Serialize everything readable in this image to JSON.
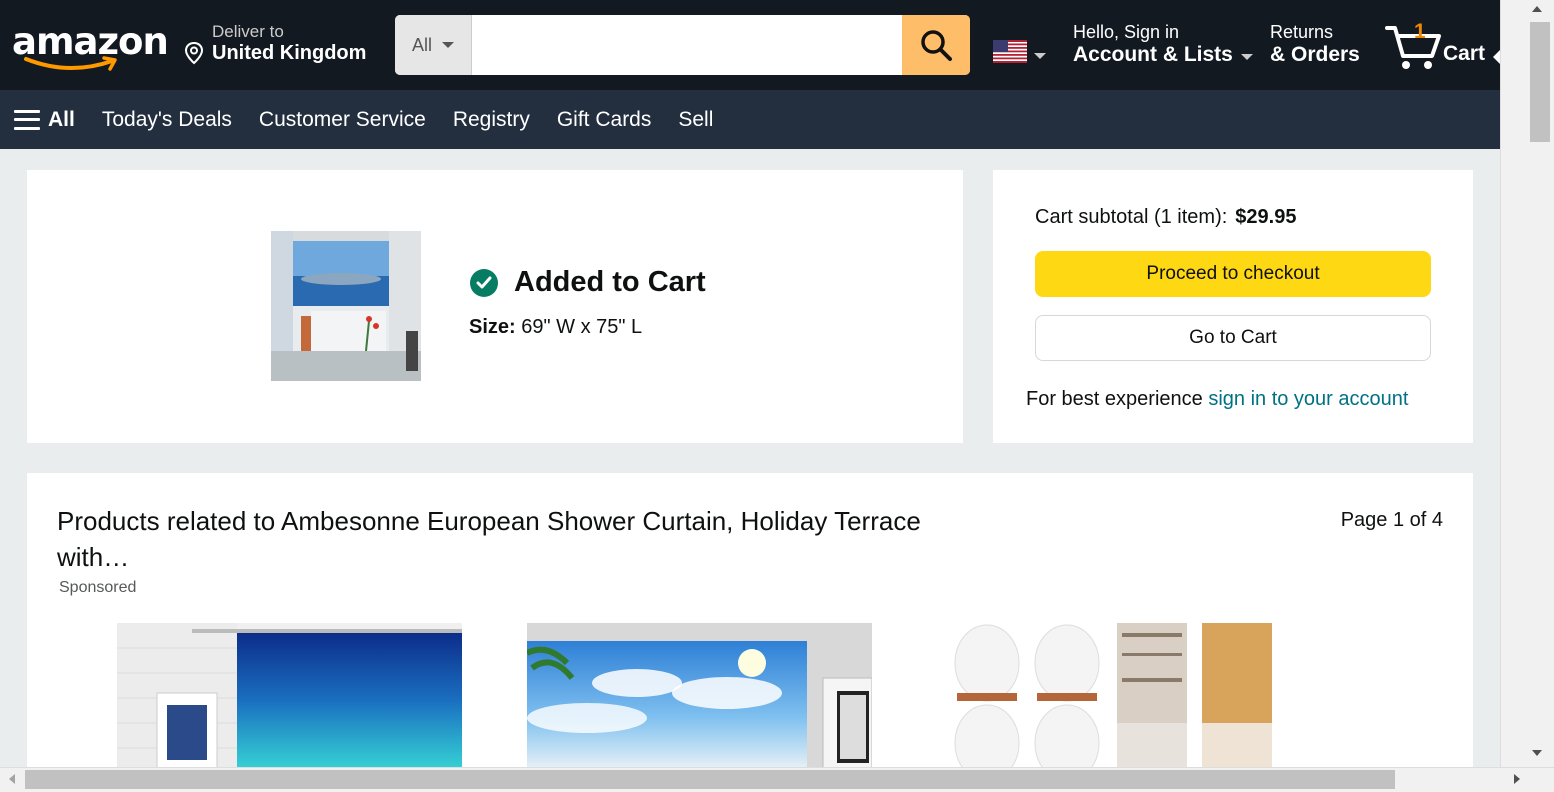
{
  "header": {
    "logo_text": "amazon",
    "deliver_line1": "Deliver to",
    "deliver_line2": "United Kingdom",
    "search_category": "All",
    "search_placeholder": "",
    "account_line1": "Hello, Sign in",
    "account_line2": "Account & Lists",
    "returns_line1": "Returns",
    "returns_line2": "& Orders",
    "cart_count": "1",
    "cart_label": "Cart"
  },
  "subnav": {
    "all_label": "All",
    "links": [
      "Today's Deals",
      "Customer Service",
      "Registry",
      "Gift Cards",
      "Sell"
    ]
  },
  "added": {
    "title": "Added to Cart",
    "size_label": "Size:",
    "size_value": "69\" W x 75\" L"
  },
  "subtotal": {
    "label": "Cart subtotal (1 item):",
    "amount": "$29.95",
    "checkout_button": "Proceed to checkout",
    "cart_button": "Go to Cart",
    "best_exp_text": "For best experience ",
    "sign_in_link": "sign in to your account"
  },
  "related": {
    "title": "Products related to Ambesonne European Shower Curtain, Holiday Terrace with…",
    "page_indicator": "Page 1 of 4",
    "sponsored": "Sponsored"
  },
  "colors": {
    "nav_dark": "#131921",
    "nav_sub": "#232f3e",
    "search_button": "#febd69",
    "checkout_yellow": "#ffd814",
    "link_teal": "#007185",
    "check_green": "#067d62",
    "cart_count_orange": "#f08804"
  },
  "icons": {
    "search": "search-icon",
    "location": "location-pin-icon",
    "cart": "cart-icon",
    "check": "check-circle-icon",
    "flag": "us-flag-icon",
    "menu": "hamburger-menu-icon"
  }
}
